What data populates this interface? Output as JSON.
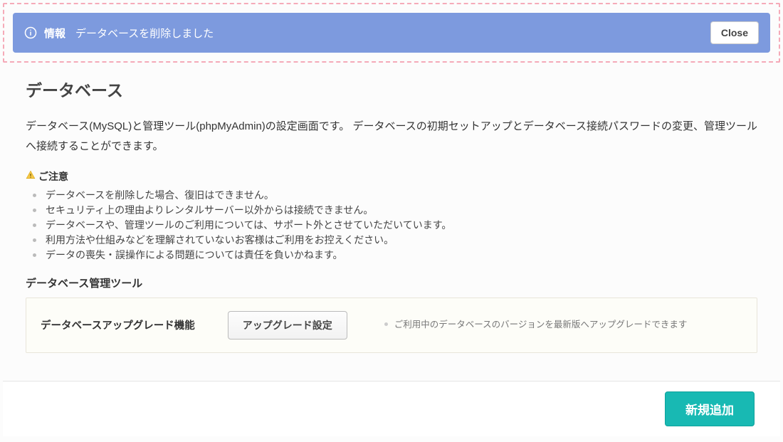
{
  "banner": {
    "label": "情報",
    "message": "データベースを削除しました",
    "close_label": "Close"
  },
  "page": {
    "title": "データベース",
    "description": "データベース(MySQL)と管理ツール(phpMyAdmin)の設定画面です。 データベースの初期セットアップとデータベース接続パスワードの変更、管理ツールへ接続することができます。"
  },
  "caution": {
    "heading": "ご注意",
    "items": [
      "データベースを削除した場合、復旧はできません。",
      "セキュリティ上の理由よりレンタルサーバー以外からは接続できません。",
      "データベースや、管理ツールのご利用については、サポート外とさせていただいています。",
      "利用方法や仕組みなどを理解されていないお客様はご利用をお控えください。",
      "データの喪失・誤操作による問題については責任を負いかねます。"
    ]
  },
  "tools": {
    "section_title": "データベース管理ツール",
    "upgrade": {
      "label": "データベースアップグレード機能",
      "button": "アップグレード設定",
      "note": "ご利用中のデータベースのバージョンを最新版へアップグレードできます"
    }
  },
  "footer": {
    "add_button": "新規追加"
  }
}
